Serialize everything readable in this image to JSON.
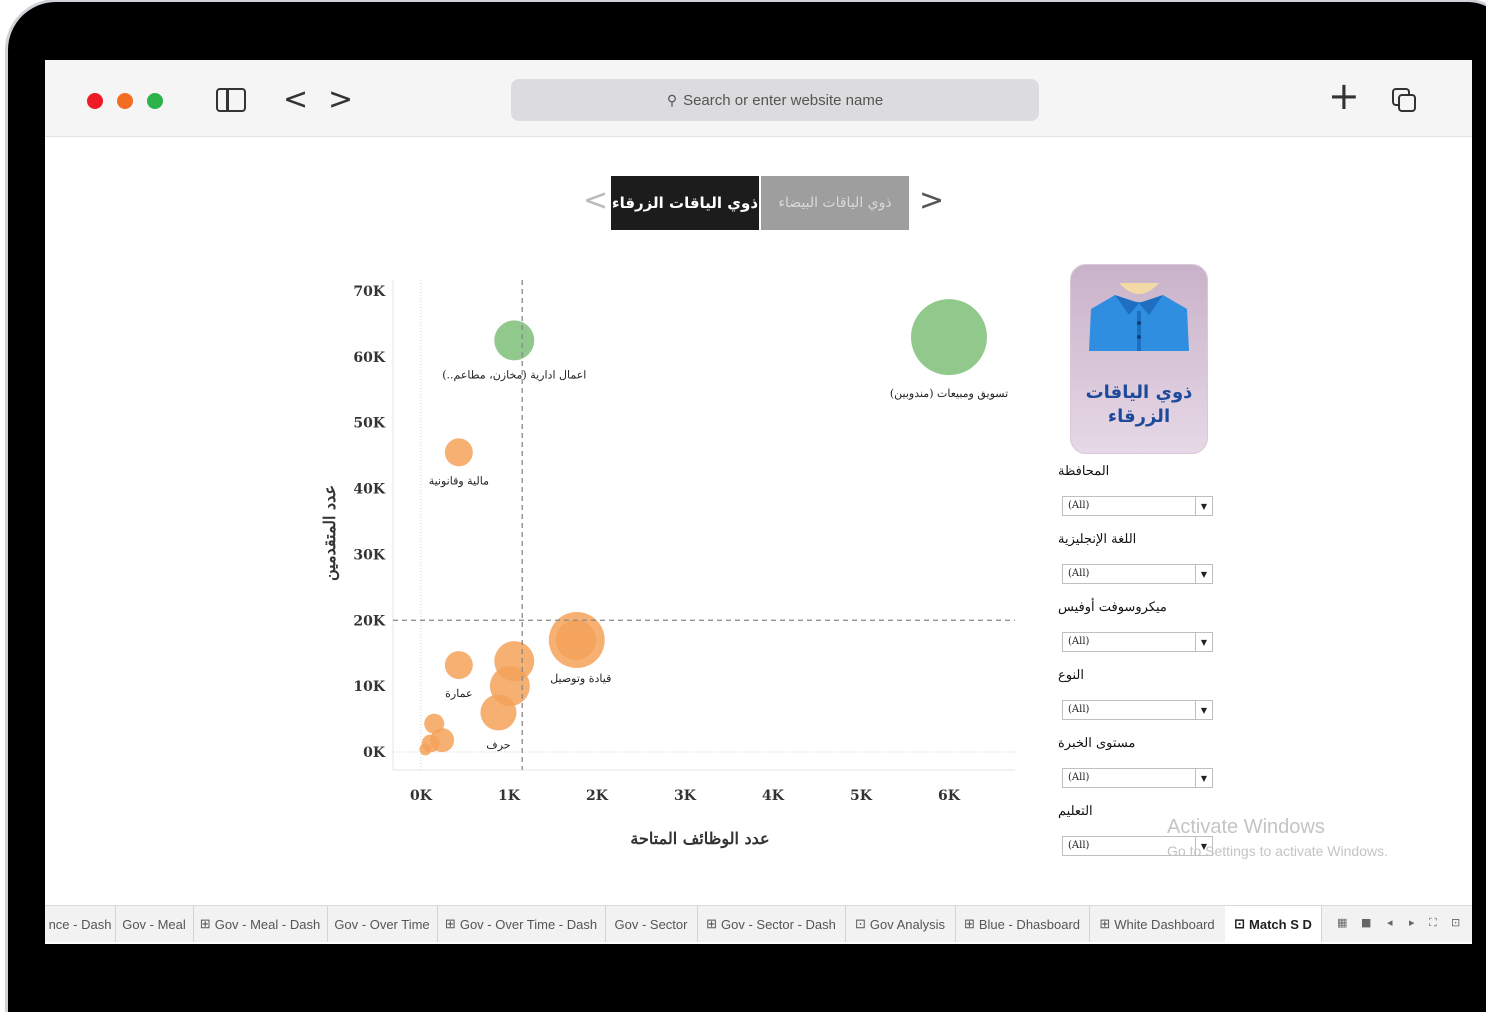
{
  "browser": {
    "search_placeholder": "Search or enter website name",
    "back": "<",
    "forward": ">",
    "new_tab": "+"
  },
  "toggle": {
    "active_label": "ذوي الياقات الزرقاء",
    "inactive_label": "ذوي الياقات البيضاء",
    "prev": "<",
    "next": ">"
  },
  "badge": {
    "title_line1": "ذوي الياقات",
    "title_line2": "الزرقاء"
  },
  "filters": [
    {
      "label": "المحافظة",
      "value": "(All)"
    },
    {
      "label": "اللغة الإنجليزية",
      "value": "(All)"
    },
    {
      "label": "ميكروسوفت أوفيس",
      "value": "(All)"
    },
    {
      "label": "النوع",
      "value": "(All)"
    },
    {
      "label": "مستوى الخبرة",
      "value": "(All)"
    },
    {
      "label": "التعليم",
      "value": "(All)"
    }
  ],
  "watermark": {
    "line1": "Activate Windows",
    "line2": "Go to Settings to activate Windows."
  },
  "tabs": [
    {
      "label": "nce - Dash",
      "icon": ""
    },
    {
      "label": "Gov - Meal",
      "icon": ""
    },
    {
      "label": "Gov - Meal - Dash",
      "icon": "⊞"
    },
    {
      "label": "Gov - Over Time",
      "icon": ""
    },
    {
      "label": "Gov - Over Time - Dash",
      "icon": "⊞"
    },
    {
      "label": "Gov - Sector",
      "icon": ""
    },
    {
      "label": "Gov - Sector - Dash",
      "icon": "⊞"
    },
    {
      "label": "Gov Analysis",
      "icon": "⊡"
    },
    {
      "label": "Blue - Dhasboard",
      "icon": "⊞"
    },
    {
      "label": "White Dashboard",
      "icon": "⊞"
    },
    {
      "label": "Match S D",
      "icon": "⊡"
    }
  ],
  "colors": {
    "orange": "#f4a259",
    "green": "#7cbf77",
    "toggle_active_bg": "#1c1c1c",
    "toggle_inactive_bg": "#9e9e9e",
    "badge_title": "#1d4a9a"
  },
  "chart_data": {
    "type": "scatter",
    "xlabel": "عدد الوظائف المتاحة",
    "ylabel": "عدد المتقدمين",
    "x_ticks": [
      "0K",
      "1K",
      "2K",
      "3K",
      "4K",
      "5K",
      "6K"
    ],
    "y_ticks": [
      "0K",
      "10K",
      "20K",
      "30K",
      "40K",
      "50K",
      "60K",
      "70K"
    ],
    "xlim": [
      0,
      6800
    ],
    "ylim": [
      0,
      70000
    ],
    "ref_x": 1150,
    "ref_y": 20000,
    "points": [
      {
        "x": 6000,
        "y": 63000,
        "size": 38,
        "color": "green",
        "label": "تسويق ومبيعات (مندوبين)"
      },
      {
        "x": 1060,
        "y": 62500,
        "size": 20,
        "color": "green",
        "label": "اعمال ادارية (مخازن، مطاعم..)"
      },
      {
        "x": 430,
        "y": 45500,
        "size": 14,
        "color": "orange",
        "label": "مالية وقانونية"
      },
      {
        "x": 1770,
        "y": 17000,
        "size": 28,
        "color": "orange",
        "label": "قيادة وتوصيل"
      },
      {
        "x": 1760,
        "y": 17000,
        "size": 20,
        "color": "orange",
        "label": ""
      },
      {
        "x": 1060,
        "y": 13800,
        "size": 20,
        "color": "orange",
        "label": ""
      },
      {
        "x": 1010,
        "y": 10000,
        "size": 20,
        "color": "orange",
        "label": ""
      },
      {
        "x": 430,
        "y": 13200,
        "size": 14,
        "color": "orange",
        "label": "عمارة"
      },
      {
        "x": 880,
        "y": 6000,
        "size": 18,
        "color": "orange",
        "label": "حرف"
      },
      {
        "x": 150,
        "y": 4300,
        "size": 10,
        "color": "orange",
        "label": ""
      },
      {
        "x": 240,
        "y": 1800,
        "size": 12,
        "color": "orange",
        "label": ""
      },
      {
        "x": 110,
        "y": 1300,
        "size": 9,
        "color": "orange",
        "label": ""
      },
      {
        "x": 50,
        "y": 400,
        "size": 6,
        "color": "orange",
        "label": ""
      }
    ]
  }
}
